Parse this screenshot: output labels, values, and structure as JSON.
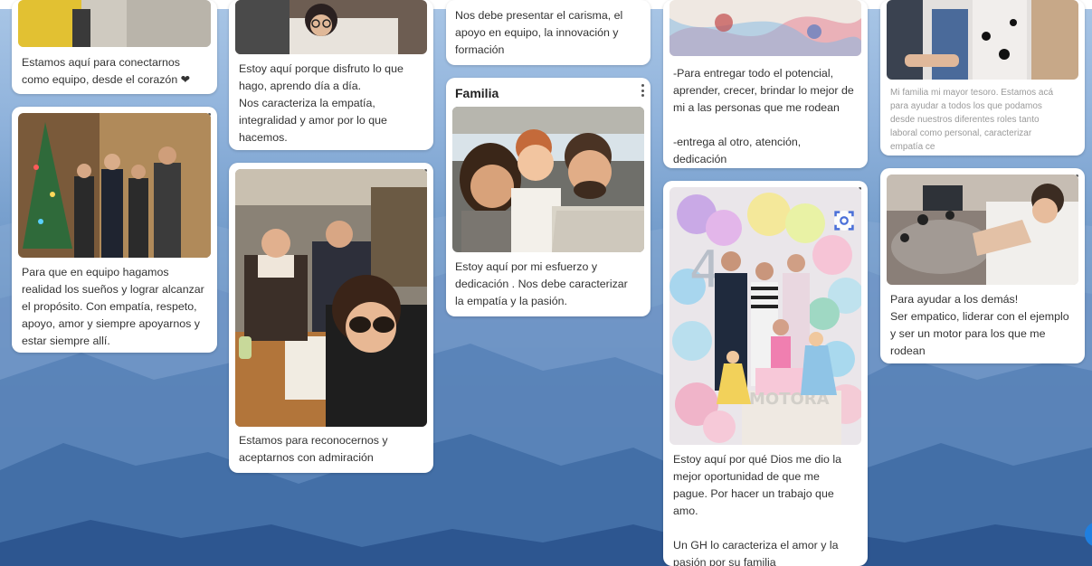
{
  "colors": {
    "accent": "#1f7fe0",
    "card": "#ffffff",
    "text": "#333333"
  },
  "cards": [
    {
      "id": "c1",
      "text": "Estamos aquí para conectarnos\ncomo equipo, desde el corazón ❤"
    },
    {
      "id": "c2",
      "text": "Para que en equipo hagamos\nrealidad los sueños y lograr alcanzar\nel propósito. Con empatía, respeto,\napoyo, amor y siempre apoyarnos y\nestar siempre allí."
    },
    {
      "id": "c3",
      "text": "Estoy aquí porque disfruto lo que\nhago, aprendo día a día.\nNos caracteriza la empatía,\nintegralidad y amor por lo que\nhacemos."
    },
    {
      "id": "c4",
      "text": "Estamos para reconocernos y\naceptarnos con admiración"
    },
    {
      "id": "c5",
      "text": "Nos debe presentar el carisma, el\napoyo en equipo, la innovación y\nformación"
    },
    {
      "id": "c6",
      "title": "Familia",
      "text": "Estoy aquí por mi esfuerzo y\ndedicación . Nos debe caracterizar\nla empatía y la pasión."
    },
    {
      "id": "c7",
      "text": "-Para entregar todo el potencial,\naprender, crecer, brindar lo mejor de\nmi a las personas que me rodean\n\n-entrega al otro, atención,\ndedicación"
    },
    {
      "id": "c8",
      "text": "Estoy aquí por qué Dios me dio la\nmejor oportunidad de que me\npague. Por hacer un trabajo que\namo.\n\nUn GH lo caracteriza el amor y la\npasión por su familia"
    },
    {
      "id": "c9",
      "text": "Mi familia mi mayor tesoro. Estamos acá\npara ayudar a todos los que podamos\ndesde nuestros diferentes roles tanto\nlaboral como personal, caracterizar\nempatía ce"
    },
    {
      "id": "c10",
      "text": "Para ayudar a los demás!\nSer empatico, liderar con el ejemplo\ny ser un motor para los que me\nrodean"
    }
  ]
}
